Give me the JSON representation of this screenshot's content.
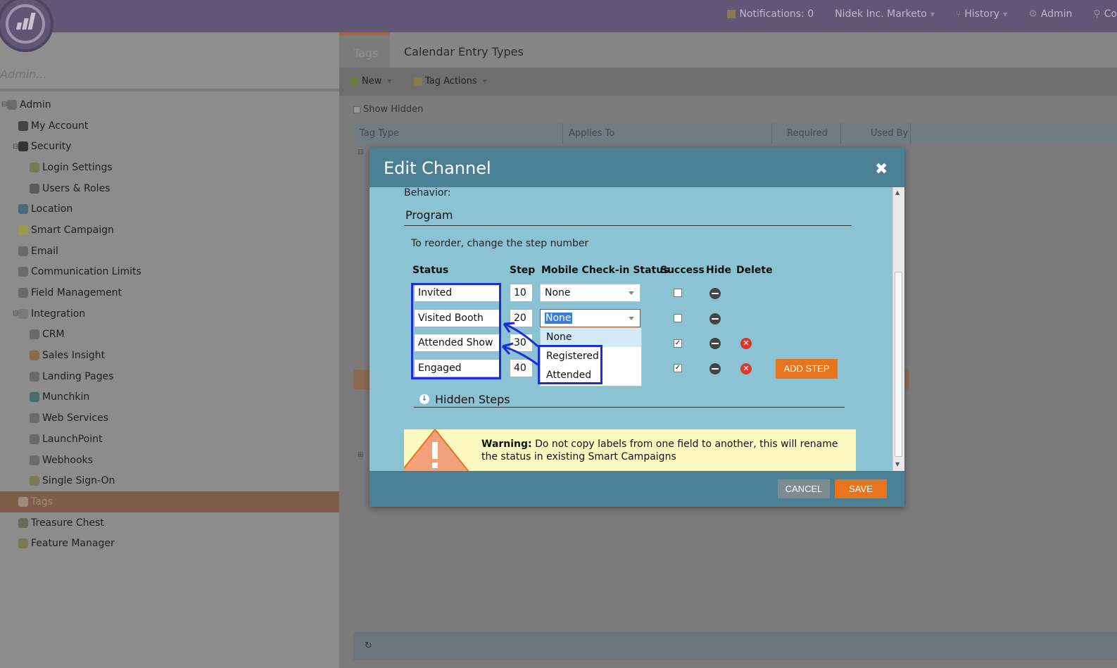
{
  "topbar": {
    "notifications": "Notifications: 0",
    "workspace": "Nidek Inc. Marketo",
    "history": "History",
    "admin": "Admin",
    "community": "Co"
  },
  "left": {
    "search_placeholder": "Admin...",
    "tree": [
      {
        "label": "Admin",
        "level": 0,
        "expander": "⊟",
        "icon": "gear-icon",
        "color": "#6b6b6b"
      },
      {
        "label": "My Account",
        "level": 1,
        "icon": "person-icon",
        "color": "#444444"
      },
      {
        "label": "Security",
        "level": 1,
        "expander": "⊟",
        "icon": "lock-icon",
        "color": "#333333"
      },
      {
        "label": "Login Settings",
        "level": 2,
        "icon": "key-icon",
        "color": "#7a7a52"
      },
      {
        "label": "Users & Roles",
        "level": 2,
        "icon": "users-icon",
        "color": "#5a5a5a"
      },
      {
        "label": "Location",
        "level": 1,
        "icon": "globe-icon",
        "color": "#4a6a7a"
      },
      {
        "label": "Smart Campaign",
        "level": 1,
        "icon": "bulb-icon",
        "color": "#9a9a4a"
      },
      {
        "label": "Email",
        "level": 1,
        "icon": "email-icon",
        "color": "#6a6a6a"
      },
      {
        "label": "Communication Limits",
        "level": 1,
        "icon": "at-icon",
        "color": "#6a6a6a"
      },
      {
        "label": "Field Management",
        "level": 1,
        "icon": "field-icon",
        "color": "#6a6a6a"
      },
      {
        "label": "Integration",
        "level": 1,
        "expander": "⊟",
        "icon": "cloud-icon",
        "color": "#7a7a7a"
      },
      {
        "label": "CRM",
        "level": 2,
        "icon": "building-icon",
        "color": "#6a6a6a"
      },
      {
        "label": "Sales Insight",
        "level": 2,
        "icon": "sales-icon",
        "color": "#8a6a4a"
      },
      {
        "label": "Landing Pages",
        "level": 2,
        "icon": "page-icon",
        "color": "#6a6a6a"
      },
      {
        "label": "Munchkin",
        "level": 2,
        "icon": "munchkin-icon",
        "color": "#4a6a6a"
      },
      {
        "label": "Web Services",
        "level": 2,
        "icon": "webservices-icon",
        "color": "#6a6a6a"
      },
      {
        "label": "LaunchPoint",
        "level": 2,
        "icon": "rocket-icon",
        "color": "#6a6a6a"
      },
      {
        "label": "Webhooks",
        "level": 2,
        "icon": "webhook-icon",
        "color": "#6a6a6a"
      },
      {
        "label": "Single Sign-On",
        "level": 2,
        "icon": "key-icon",
        "color": "#7a7a52"
      },
      {
        "label": "Tags",
        "level": 1,
        "icon": "tag-icon",
        "color": "#9e8a7a",
        "selected": true
      },
      {
        "label": "Treasure Chest",
        "level": 1,
        "icon": "chest-icon",
        "color": "#6a6a5a"
      },
      {
        "label": "Feature Manager",
        "level": 1,
        "icon": "wand-icon",
        "color": "#7a7a52"
      }
    ]
  },
  "right": {
    "tab_tags": "Tags",
    "tab_calendar": "Calendar Entry Types",
    "toolbar_new": "New",
    "toolbar_tag_actions": "Tag Actions",
    "show_hidden": "Show Hidden",
    "col_tag_type": "Tag Type",
    "col_applies_to": "Applies To",
    "col_required": "Required",
    "col_used_by": "Used By"
  },
  "modal": {
    "title": "Edit Channel",
    "behavior_label": "Behavior:",
    "program_label": "Program",
    "reorder_hint": "To reorder, change the step number",
    "headers": {
      "status": "Status",
      "step": "Step",
      "mobile": "Mobile Check-in Status",
      "success": "Success",
      "hide": "Hide",
      "delete": "Delete"
    },
    "rows": [
      {
        "status": "Invited",
        "step": "10",
        "mobile": "None",
        "success": false,
        "deletable": false
      },
      {
        "status": "Visited Booth",
        "step": "20",
        "mobile": "None",
        "success": false,
        "deletable": false
      },
      {
        "status": "Attended Show",
        "step": "30",
        "mobile": "",
        "success": true,
        "deletable": true
      },
      {
        "status": "Engaged",
        "step": "40",
        "mobile": "",
        "success": true,
        "deletable": true
      }
    ],
    "dropdown_options": [
      "None",
      "Registered",
      "Attended"
    ],
    "add_step": "ADD STEP",
    "hidden_steps": "Hidden Steps",
    "warning_bold": "Warning:",
    "warning_text": "Do not copy labels from one field to another, this will rename the status in existing Smart Campaigns",
    "cancel": "CANCEL",
    "save": "SAVE"
  },
  "colors": {
    "accent_orange": "#e8741e",
    "modal_header": "#4b7f94",
    "modal_body": "#8bc2d4",
    "annotation_blue": "#1a2fd6",
    "topbar": "#5f5775"
  }
}
